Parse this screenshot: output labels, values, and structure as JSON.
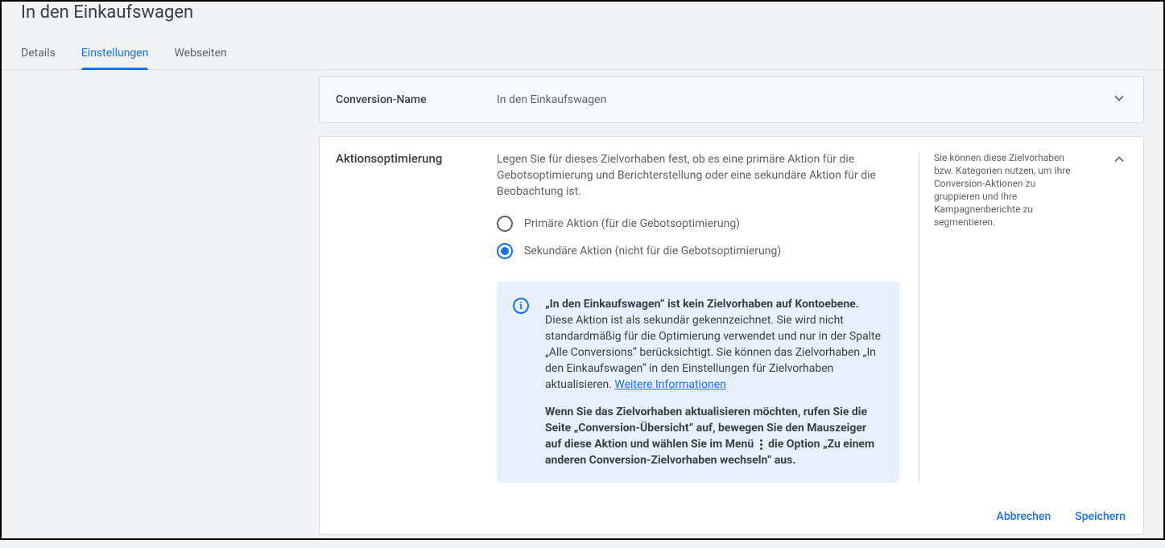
{
  "header": {
    "title": "In den Einkaufswagen"
  },
  "tabs": {
    "details": "Details",
    "settings": "Einstellungen",
    "webpages": "Webseiten"
  },
  "conversion_card": {
    "label": "Conversion-Name",
    "value": "In den Einkaufswagen"
  },
  "action_opt": {
    "label": "Aktionsoptimierung",
    "desc": "Legen Sie für dieses Zielvorhaben fest, ob es eine primäre Aktion für die Gebotsoptimierung und Berichterstellung oder eine sekundäre Aktion für die Beobachtung ist.",
    "radio_primary": "Primäre Aktion (für die Gebotsoptimierung)",
    "radio_secondary": "Sekundäre Aktion (nicht für die Gebotsoptimierung)",
    "info": {
      "bold_lead": "„In den Einkaufswagen“ ist kein Zielvorhaben auf Kontoebene.",
      "body": " Diese Aktion ist als sekundär gekennzeichnet. Sie wird nicht standardmäßig für die Optimierung verwendet und nur in der Spalte „Alle Conversions“ berücksichtigt. Sie können das Zielvorhaben „In den Einkaufswagen“ in den Einstellungen für Zielvorhaben aktualisieren. ",
      "link": "Weitere Informationen",
      "para2_a": "Wenn Sie das Zielvorhaben aktualisieren möchten, rufen Sie die Seite „Conversion-Übersicht“ auf, bewegen Sie den Mauszeiger auf diese Aktion und wählen Sie im Menü",
      "para2_b": "die Option „Zu einem anderen Conversion-Zielvorhaben wechseln“ aus."
    },
    "side_help": "Sie können diese Zielvorhaben bzw. Kategorien nutzen, um Ihre Conversion-Aktionen zu gruppieren und Ihre Kampagnenberichte zu segmentieren."
  },
  "footer": {
    "cancel": "Abbrechen",
    "save": "Speichern"
  }
}
